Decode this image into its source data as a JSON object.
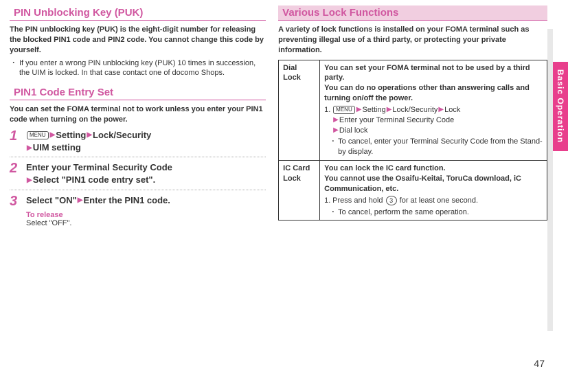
{
  "left": {
    "puk_title": "PIN Unblocking Key (PUK)",
    "puk_desc": "The PIN unblocking key (PUK) is the eight-digit number for releasing the blocked PIN1 code and PIN2 code. You cannot change this code by yourself.",
    "puk_bullet": "If you enter a wrong PIN unblocking key (PUK) 10 times in succession, the UIM is locked. In that case contact one of docomo Shops.",
    "pin1_title": "PIN1 Code Entry Set",
    "pin1_desc": "You can set the FOMA terminal not to work unless you enter your PIN1 code when turning on the power.",
    "steps": {
      "s1_num": "1",
      "s1_menu": "MENU",
      "s1_a": "Setting",
      "s1_b": "Lock/Security",
      "s1_c": "UIM setting",
      "s2_num": "2",
      "s2_a": "Enter your Terminal Security Code",
      "s2_b": "Select \"PIN1 code entry set\".",
      "s3_num": "3",
      "s3_a": "Select \"ON\"",
      "s3_b": "Enter the PIN1 code."
    },
    "release_label": "To release",
    "release_text": "Select \"OFF\"."
  },
  "right": {
    "title": "Various Lock Functions",
    "desc": "A variety of lock functions is installed on your FOMA terminal such as preventing illegal use of a third party, or protecting your private information.",
    "dial": {
      "label": "Dial Lock",
      "p1": "You can set your FOMA terminal not to be used by a third party.",
      "p2": "You can do no operations other than answering calls and turning on/off the power.",
      "menu": "MENU",
      "a": "Setting",
      "b": "Lock/Security",
      "c": "Lock",
      "d": "Enter your Terminal Security Code",
      "e": "Dial lock",
      "bullet": "To cancel, enter your Terminal Security Code from the Stand-by display."
    },
    "ic": {
      "label": "IC Card Lock",
      "p1": "You can lock the IC card function.",
      "p2": "You cannot use the Osaifu-Keitai, ToruCa download, iC Communication, etc.",
      "step_a": "Press and hold ",
      "key3": "3",
      "step_b": " for at least one second.",
      "bullet": "To cancel, perform the same operation."
    }
  },
  "side_tab": "Basic Operation",
  "page_number": "47"
}
